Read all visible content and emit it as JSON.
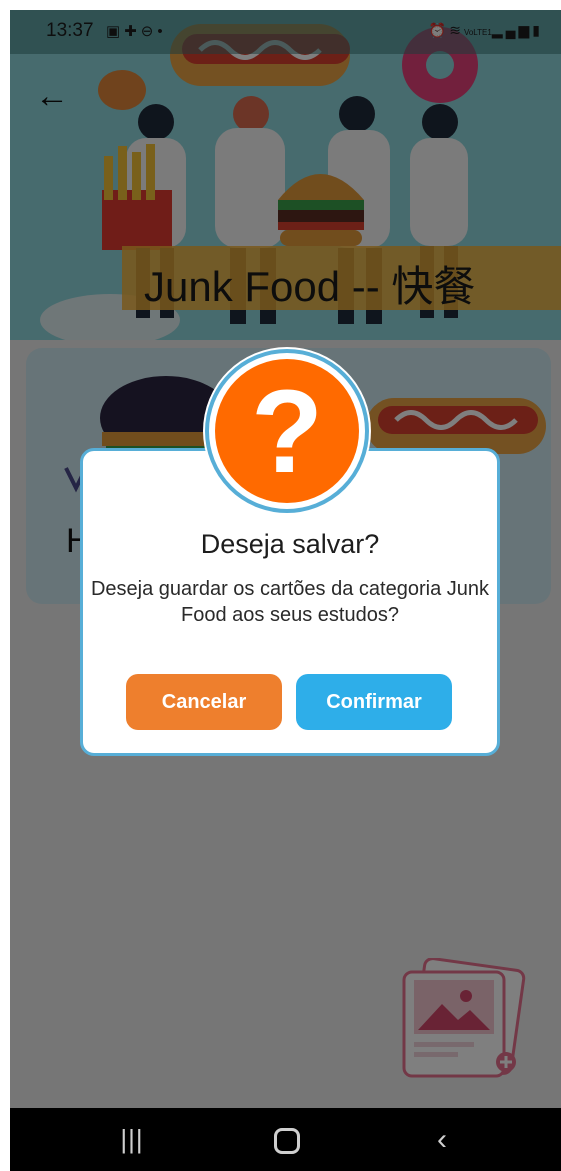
{
  "status_bar": {
    "time": "13:37",
    "left_icons": [
      "image-icon",
      "puzzle-icon",
      "minus-circle-icon",
      "dot-icon"
    ],
    "right_icons": [
      "alarm-icon",
      "wifi-icon",
      "volte-icon",
      "signal-icon",
      "battery-icon"
    ],
    "volte_label": "VoLTE1"
  },
  "header": {
    "back_icon": "arrow-left-icon",
    "category_title": "Junk Food -- 快餐"
  },
  "content": {
    "card_title": "H"
  },
  "dialog": {
    "icon": "question-icon",
    "title": "Deseja salvar?",
    "message": "Deseja guardar os cartões da categoria Junk Food aos seus estudos?",
    "cancel_label": "Cancelar",
    "confirm_label": "Confirmar"
  },
  "navigation": {
    "recents_icon": "recents-icon",
    "home_icon": "home-icon",
    "back_icon": "chevron-left-icon"
  },
  "colors": {
    "cancel": "#ee7f2d",
    "confirm": "#2eaee9",
    "question_circle": "#ff6a00",
    "dialog_border": "#57aed7",
    "banner": "#f3b238"
  }
}
